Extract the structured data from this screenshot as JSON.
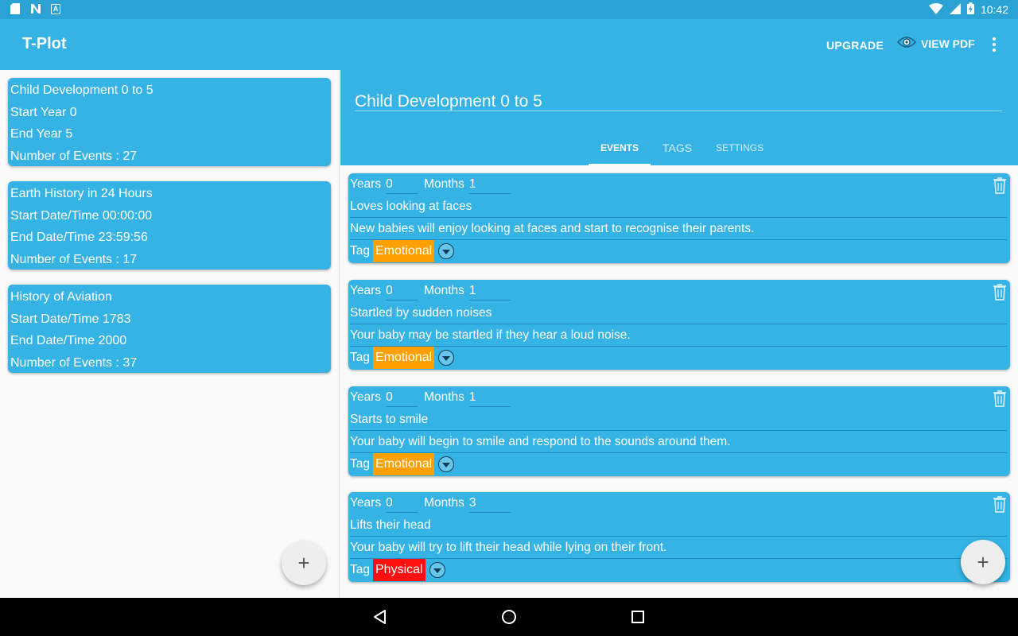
{
  "status_bar": {
    "time": "10:42",
    "left_icons": [
      "sd-card-icon",
      "n-notification-icon",
      "a-notification-icon"
    ],
    "right_icons": [
      "wifi-icon",
      "signal-icon",
      "battery-icon"
    ]
  },
  "app_bar": {
    "title": "T-Plot",
    "upgrade_label": "UPGRADE",
    "view_pdf_label": "VIEW PDF",
    "view_pdf_icon": "eye-icon",
    "overflow_icon": "more-vert-icon"
  },
  "plots": [
    {
      "name": "Child Development 0 to 5",
      "start": "Start Year  0",
      "end": "End Year  5",
      "events": "Number of Events : 27"
    },
    {
      "name": "Earth History in 24 Hours",
      "start": "Start Date/Time  00:00:00",
      "end": "End Date/Time  23:59:56",
      "events": "Number of Events : 17"
    },
    {
      "name": "History of Aviation",
      "start": "Start Date/Time  1783",
      "end": "End Date/Time  2000",
      "events": "Number of Events : 37"
    }
  ],
  "detail": {
    "title": "Child Development 0 to 5",
    "tabs": [
      "EVENTS",
      "TAGS",
      "SETTINGS"
    ],
    "active_tab": "EVENTS"
  },
  "event_labels": {
    "years": "Years",
    "months": "Months",
    "tag": "Tag"
  },
  "events": [
    {
      "years": "0",
      "months": "1",
      "title": "Loves looking at faces",
      "description": "New babies will enjoy looking at faces and start to recognise their parents.",
      "tag": "Emotional",
      "tag_color": "#ffa000"
    },
    {
      "years": "0",
      "months": "1",
      "title": "Startled by sudden noises",
      "description": "Your baby may be startled if they hear a loud noise.",
      "tag": "Emotional",
      "tag_color": "#ffa000"
    },
    {
      "years": "0",
      "months": "1",
      "title": "Starts to smile",
      "description": "Your baby will begin to smile and respond to the sounds around them.",
      "tag": "Emotional",
      "tag_color": "#ffa000"
    },
    {
      "years": "0",
      "months": "3",
      "title": "Lifts their head",
      "description": "Your baby will try to lift their head while lying on their front.",
      "tag": "Physical",
      "tag_color": "#ff1010"
    }
  ],
  "fab_label": "+",
  "colors": {
    "primary": "#35b3e5",
    "status_bar": "#2aa3d4",
    "emotional": "#ffa000",
    "physical": "#ff1010"
  }
}
